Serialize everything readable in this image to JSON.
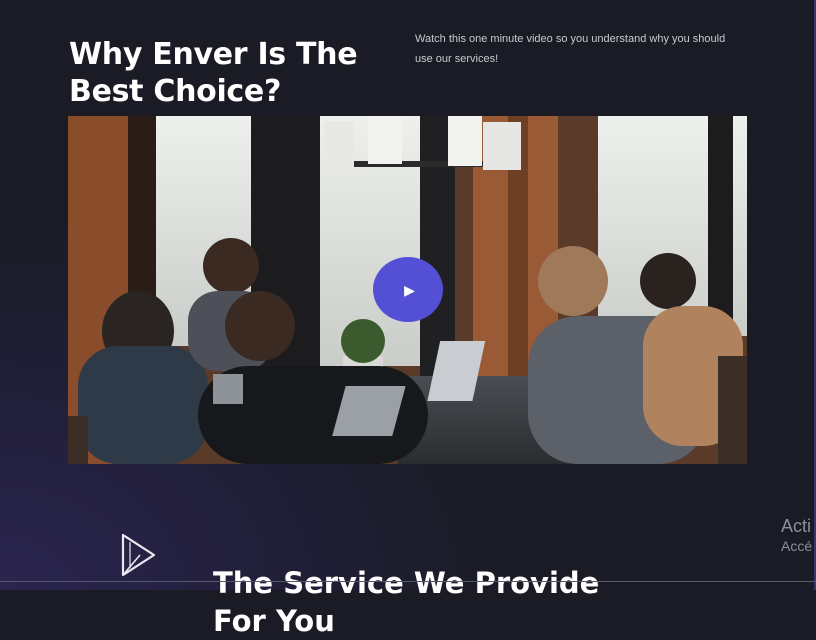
{
  "header": {
    "headline": "Why Enver Is The Best Choice?",
    "intro": "Watch this one minute video so you understand why you should use our services!"
  },
  "video": {
    "play_icon": "▶",
    "accent_color": "#5350d6"
  },
  "services": {
    "title": "The Service We Provide For You",
    "icon": "play-outline-icon"
  },
  "watermark": {
    "line1": "Acti",
    "line2": "Accé"
  }
}
